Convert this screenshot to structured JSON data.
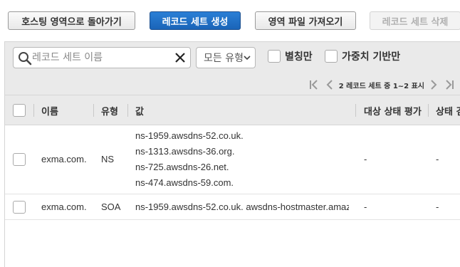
{
  "toolbar": {
    "back_label": "호스팅 영역으로 돌아가기",
    "create_label": "레코드 세트 생성",
    "import_label": "영역 파일 가져오기",
    "delete_label": "레코드 세트 삭제"
  },
  "filters": {
    "search_placeholder": "레코드 세트 이름",
    "search_value": "",
    "type_select": "모든 유형",
    "alias_label": "별칭만",
    "weighted_label": "가중치 기반만"
  },
  "pager": {
    "text": "2 레코드 세트 중 1~2 표시"
  },
  "columns": {
    "name": "이름",
    "type": "유형",
    "value": "값",
    "evaluate_target_health": "대상 상태 평가",
    "health_check": "상태 검"
  },
  "rows": [
    {
      "name": "exma.com.",
      "type": "NS",
      "values": [
        "ns-1959.awsdns-52.co.uk.",
        "ns-1313.awsdns-36.org.",
        "ns-725.awsdns-26.net.",
        "ns-474.awsdns-59.com."
      ],
      "evaluate": "-",
      "health": "-"
    },
    {
      "name": "exma.com.",
      "type": "SOA",
      "values": [
        "ns-1959.awsdns-52.co.uk. awsdns-hostmaster.amaz"
      ],
      "evaluate": "-",
      "health": "-"
    }
  ],
  "colors": {
    "primary": "#1a64b8",
    "header_bg": "#eaeaea",
    "border": "#d5d5d5"
  },
  "icons": [
    "search-icon",
    "clear-icon",
    "chevron-down-icon",
    "first-page-icon",
    "prev-page-icon",
    "next-page-icon",
    "last-page-icon"
  ]
}
